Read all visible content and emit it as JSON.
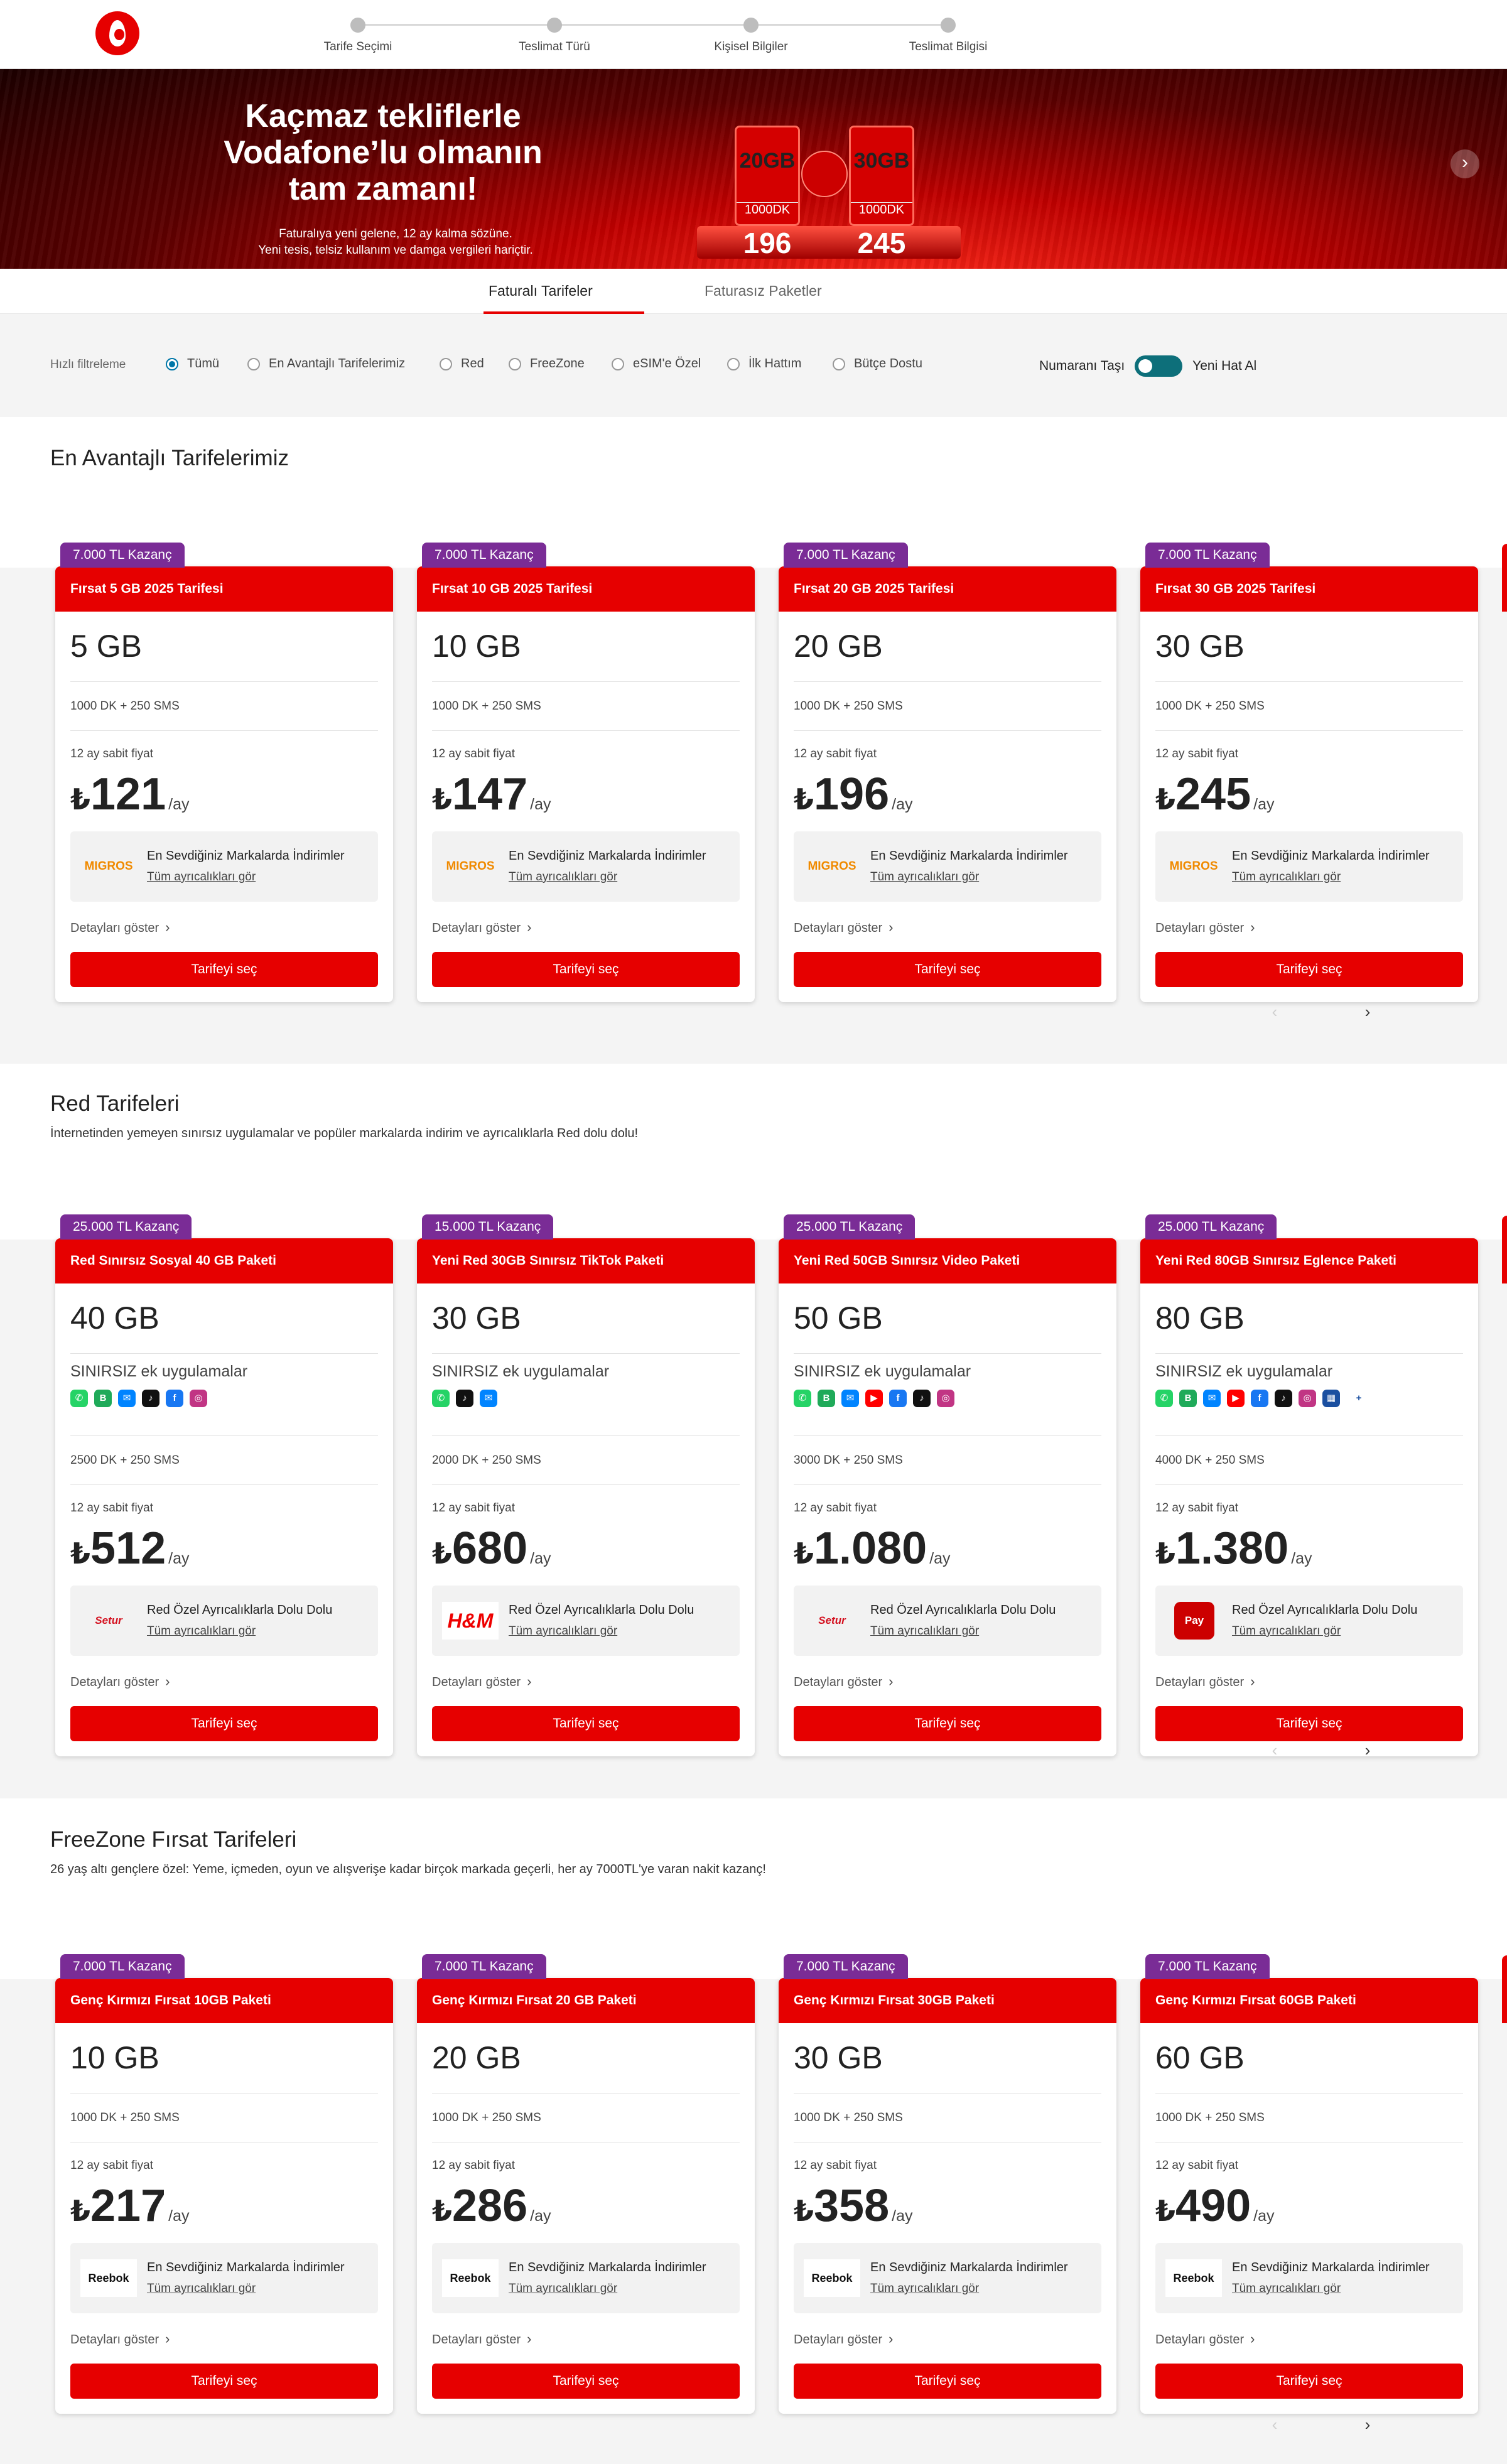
{
  "header": {
    "steps": [
      "Tarife Seçimi",
      "Teslimat Türü",
      "Kişisel Bilgiler",
      "Teslimat Bilgisi"
    ]
  },
  "banner": {
    "title_line1": "Kaçmaz tekliflerle",
    "title_line2": "Vodafone’lu olmanın",
    "title_line3": "tam zamanı!",
    "sub_line1": "Faturalıya yeni gelene, 12 ay kalma sözüne.",
    "sub_line2": "Yeni tesis, telsiz kullanım ve damga vergileri hariçtir.",
    "promo1_gb": "20GB",
    "promo1_dk": "1000DK",
    "promo1_price": "196",
    "promo2_gb": "30GB",
    "promo2_dk": "1000DK",
    "promo2_price": "245",
    "next_icon": "›"
  },
  "tabs": {
    "active": "Faturalı Tarifeler",
    "inactive": "Faturasız Paketler"
  },
  "filters": {
    "label": "Hızlı filtreleme",
    "options": [
      "Tümü",
      "En Avantajlı Tarifelerimiz",
      "Red",
      "FreeZone",
      "eSIM'e Özel",
      "İlk Hattım",
      "Bütçe Dostu"
    ],
    "toggle_left": "Numaranı Taşı",
    "toggle_right": "Yeni Hat Al"
  },
  "common": {
    "fixed_price": "12 ay sabit fiyat",
    "currency": "₺",
    "per_month": "/ay",
    "details": "Detayları göster",
    "select": "Tarifeyi seç",
    "perks_link": "Tüm ayrıcalıkları gör",
    "apps_label": "SINIRSIZ ek uygulamalar",
    "pager_prev": "‹",
    "pager_next": "›"
  },
  "sections": [
    {
      "title": "En Avantajlı Tarifelerimiz",
      "desc": "",
      "cards": [
        {
          "badge": "7.000 TL Kazanç",
          "name": "Fırsat 5 GB 2025 Tarifesi",
          "gb": "5 GB",
          "mins": "1000 DK + 250 SMS",
          "price": "121",
          "perk_title": "En Sevdiğiniz Markalarda İndirimler",
          "perk_logo": "MIGROS"
        },
        {
          "badge": "7.000 TL Kazanç",
          "name": "Fırsat 10 GB 2025 Tarifesi",
          "gb": "10 GB",
          "mins": "1000 DK + 250 SMS",
          "price": "147",
          "perk_title": "En Sevdiğiniz Markalarda İndirimler",
          "perk_logo": "MIGROS"
        },
        {
          "badge": "7.000 TL Kazanç",
          "name": "Fırsat 20 GB 2025 Tarifesi",
          "gb": "20 GB",
          "mins": "1000 DK + 250 SMS",
          "price": "196",
          "perk_title": "En Sevdiğiniz Markalarda İndirimler",
          "perk_logo": "MIGROS"
        },
        {
          "badge": "7.000 TL Kazanç",
          "name": "Fırsat 30 GB 2025 Tarifesi",
          "gb": "30 GB",
          "mins": "1000 DK + 250 SMS",
          "price": "245",
          "perk_title": "En Sevdiğiniz Markalarda İndirimler",
          "perk_logo": "MIGROS"
        }
      ]
    },
    {
      "title": "Red Tarifeleri",
      "desc": "İnternetinden yemeyen sınırsız uygulamalar ve popüler markalarda indirim ve ayrıcalıklarla Red dolu dolu!",
      "cards": [
        {
          "badge": "25.000 TL Kazanç",
          "name": "Red Sınırsız Sosyal 40 GB Paketi",
          "gb": "40 GB",
          "mins": "2500 DK + 250 SMS",
          "price": "512",
          "perk_title": "Red Özel Ayrıcalıklarla Dolu Dolu",
          "perk_logo": "Setur",
          "apps": [
            "whatsapp",
            "wa-business",
            "messenger",
            "tiktok",
            "facebook",
            "instagram"
          ]
        },
        {
          "badge": "15.000 TL Kazanç",
          "name": "Yeni Red 30GB Sınırsız TikTok Paketi",
          "gb": "30 GB",
          "mins": "2000 DK + 250 SMS",
          "price": "680",
          "perk_title": "Red Özel Ayrıcalıklarla Dolu Dolu",
          "perk_logo": "H&M",
          "apps": [
            "whatsapp",
            "tiktok",
            "messenger"
          ]
        },
        {
          "badge": "25.000 TL Kazanç",
          "name": "Yeni Red 50GB Sınırsız Video Paketi",
          "gb": "50 GB",
          "mins": "3000 DK + 250 SMS",
          "price": "1.080",
          "perk_title": "Red Özel Ayrıcalıklarla Dolu Dolu",
          "perk_logo": "Setur",
          "apps": [
            "whatsapp",
            "wa-business",
            "messenger",
            "youtube",
            "facebook",
            "tiktok",
            "instagram"
          ]
        },
        {
          "badge": "25.000 TL Kazanç",
          "name": "Yeni Red 80GB Sınırsız Eglence Paketi",
          "gb": "80 GB",
          "mins": "4000 DK + 250 SMS",
          "price": "1.380",
          "perk_title": "Red Özel Ayrıcalıklarla Dolu Dolu",
          "perk_logo": "Pay",
          "apps": [
            "whatsapp",
            "wa-business",
            "messenger",
            "youtube",
            "facebook",
            "tiktok",
            "instagram",
            "vodafone-tv",
            "tv-plus"
          ]
        }
      ]
    },
    {
      "title": "FreeZone Fırsat Tarifeleri",
      "desc": "26 yaş altı gençlere özel: Yeme, içmeden, oyun ve alışverişe kadar birçok markada geçerli, her ay 7000TL'ye varan nakit kazanç!",
      "cards": [
        {
          "badge": "7.000 TL Kazanç",
          "name": "Genç Kırmızı Fırsat 10GB Paketi",
          "gb": "10 GB",
          "mins": "1000 DK + 250 SMS",
          "price": "217",
          "perk_title": "En Sevdiğiniz Markalarda İndirimler",
          "perk_logo": "Reebok"
        },
        {
          "badge": "7.000 TL Kazanç",
          "name": "Genç Kırmızı Fırsat 20 GB Paketi",
          "gb": "20 GB",
          "mins": "1000 DK + 250 SMS",
          "price": "286",
          "perk_title": "En Sevdiğiniz Markalarda İndirimler",
          "perk_logo": "Reebok"
        },
        {
          "badge": "7.000 TL Kazanç",
          "name": "Genç Kırmızı Fırsat 30GB Paketi",
          "gb": "30 GB",
          "mins": "1000 DK + 250 SMS",
          "price": "358",
          "perk_title": "En Sevdiğiniz Markalarda İndirimler",
          "perk_logo": "Reebok"
        },
        {
          "badge": "7.000 TL Kazanç",
          "name": "Genç Kırmızı Fırsat 60GB Paketi",
          "gb": "60 GB",
          "mins": "1000 DK + 250 SMS",
          "price": "490",
          "perk_title": "En Sevdiğiniz Markalarda İndirimler",
          "perk_logo": "Reebok"
        }
      ]
    }
  ],
  "colors": {
    "brand_red": "#e60000",
    "badge_purple": "#7a2c96",
    "toggle_teal": "#0d6f7a"
  }
}
